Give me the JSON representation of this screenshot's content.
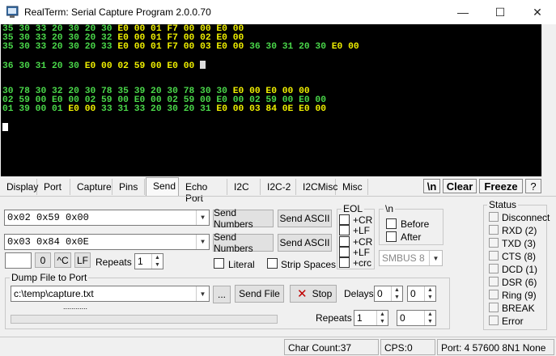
{
  "window": {
    "title": "RealTerm: Serial Capture Program 2.0.0.70",
    "minimize": "—",
    "maximize": "☐",
    "close": "✕"
  },
  "terminal": {
    "lines": [
      [
        [
          "35 30 33 20 30 20 30 ",
          "g"
        ],
        [
          "E0 00 01 F7 00 00 E0 00",
          "y"
        ]
      ],
      [
        [
          "35 30 33 20 30 20 32 ",
          "g"
        ],
        [
          "E0 00 01 F7 00 02 E0 00",
          "y"
        ]
      ],
      [
        [
          "35 30 33 20 30 20 33 ",
          "g"
        ],
        [
          "E0 00 01 F7 00 03 E0 00 ",
          "y"
        ],
        [
          "36 30 31 20 30 ",
          "g"
        ],
        [
          "E0 00",
          "y"
        ]
      ],
      [],
      [
        [
          "36 30 31 20 30 ",
          "g"
        ],
        [
          "E0 00 02 59 00 E0 00 ",
          "y"
        ],
        [
          "",
          "cursor"
        ]
      ],
      [],
      [],
      [
        [
          "30 78 30 32 20 30 78 35 39 20 30 78 30 30 ",
          "g"
        ],
        [
          "E0 00 E0 00 00",
          "y"
        ]
      ],
      [
        [
          "02 59 00 E0 00 02 59 00 E0 00 02 59 00 E0 00 02 59 00 E0 00",
          "g"
        ]
      ],
      [
        [
          "01 39 00 01 ",
          "g"
        ],
        [
          "E0 00 ",
          "y"
        ],
        [
          "33 31 33 20 30 20 31 ",
          "g"
        ],
        [
          "E0 00 03 84 0E E0 00",
          "y"
        ]
      ],
      [],
      [
        [
          "",
          "cursor-solid"
        ]
      ]
    ]
  },
  "tabs": [
    "Display",
    "Port",
    "Capture",
    "Pins",
    "Send",
    "Echo Port",
    "I2C",
    "I2C-2",
    "I2CMisc",
    "Misc"
  ],
  "active_tab": "Send",
  "toolbar": {
    "newline_label": "\\n",
    "clear_label": "Clear",
    "freeze_label": "Freeze",
    "help_label": "?"
  },
  "send": {
    "line1_value": "0x02 0x59 0x00",
    "line2_value": "0x03 0x84 0x0E",
    "send_numbers_label": "Send Numbers",
    "send_ascii_label": "Send ASCII",
    "small_input_value": "",
    "zero_label": "0",
    "ctrl_c_label": "^C",
    "lf_label": "LF",
    "repeats_label": "Repeats",
    "repeats_value": "1",
    "literal_label": "Literal",
    "strip_spaces_label": "Strip Spaces"
  },
  "eol": {
    "title": "EOL",
    "items": [
      "+CR",
      "+LF",
      "+CR",
      "+LF",
      "+crc"
    ]
  },
  "newline_group": {
    "title": "\\n",
    "before_label": "Before",
    "after_label": "After",
    "smbus_value": "SMBUS 8"
  },
  "dump": {
    "title": "Dump File to Port",
    "file_value": "c:\\temp\\capture.txt",
    "browse_label": "...",
    "progress_text": "............",
    "send_file_label": "Send File",
    "stop_label": "Stop",
    "delays_label": "Delays",
    "delay1_value": "0",
    "delay2_value": "0",
    "repeats_label": "Repeats",
    "repeats1_value": "1",
    "repeats2_value": "0"
  },
  "status": {
    "title": "Status",
    "items": [
      "Disconnect",
      "RXD (2)",
      "TXD (3)",
      "CTS (8)",
      "DCD (1)",
      "DSR (6)",
      "Ring (9)",
      "BREAK",
      "Error"
    ]
  },
  "statusbar": {
    "char_count": "Char Count:37",
    "cps": "CPS:0",
    "port": "Port: 4 57600 8N1 None"
  }
}
